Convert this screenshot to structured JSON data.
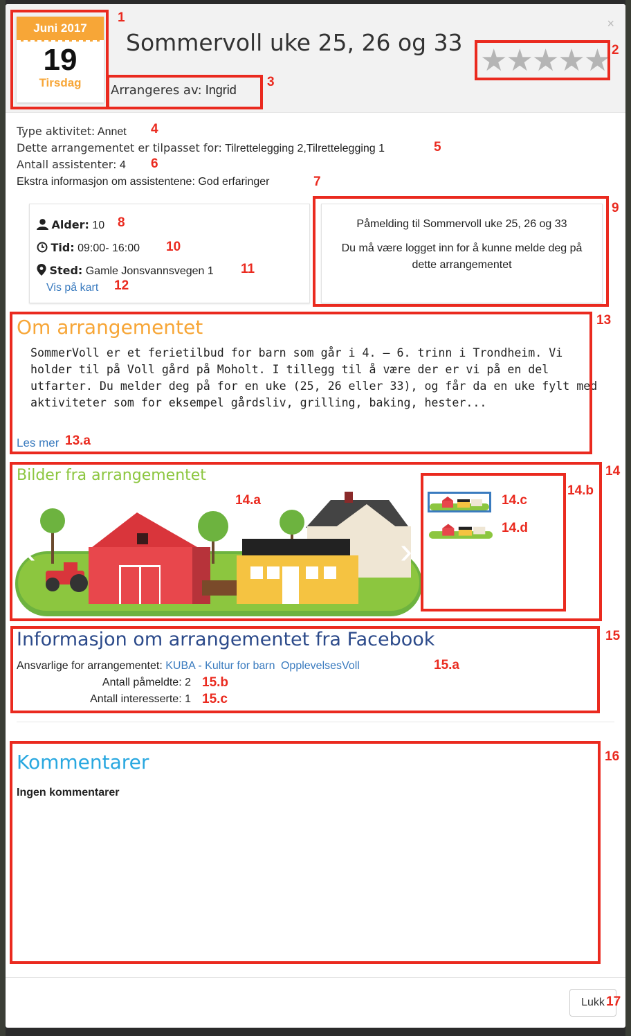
{
  "window": {
    "close_glyph": "×"
  },
  "calendar": {
    "month": "Juni 2017",
    "day": "19",
    "weekday": "Tirsdag"
  },
  "event": {
    "title": "Sommervoll uke 25, 26 og 33",
    "rating_stars": "★★★★★",
    "rating_value": 0,
    "organizer_label": "Arrangeres av:",
    "organizer_value": "Ingrid"
  },
  "details": {
    "type_label": "Type aktivitet:",
    "type_value": "Annet",
    "adapted_label": "Dette arrangementet er tilpasset for:",
    "adapted_value": "Tilrettelegging 2,Tilrettelegging 1",
    "assistants_label": "Antall assistenter:",
    "assistants_value": "4",
    "extra_label": "Ekstra informasjon om assistentene:",
    "extra_value": "God erfaringer"
  },
  "summary_card": {
    "age_label": "Alder:",
    "age_value": "10",
    "time_label": "Tid:",
    "time_value": "09:00- 16:00",
    "place_label": "Sted:",
    "place_value": "Gamle Jonsvannsvegen 1",
    "map_link": "Vis på kart"
  },
  "signup_card": {
    "heading": "Påmelding til Sommervoll uke 25, 26 og 33",
    "message": "Du må være logget inn for å kunne melde deg på dette arrangementet"
  },
  "about": {
    "title": "Om arrangementet",
    "text": "SommerVoll er et ferietilbud for barn som går i 4. – 6. trinn i Trondheim. Vi holder til på Voll gård på Moholt. I tillegg til å være der er vi på en del utfarter. Du melder deg på for en uke (25, 26 eller 33), og får da en uke fylt med aktiviteter som for eksempel gårdsliv, grilling, baking, hester...",
    "read_more": "Les mer"
  },
  "gallery": {
    "title": "Bilder fra arrangementet",
    "prev": "‹",
    "next": "›"
  },
  "facebook": {
    "title": "Informasjon om arrangementet fra Facebook",
    "responsible_label": "Ansvarlige for arrangementet:",
    "responsible_links": [
      "KUBA - Kultur for barn",
      "OpplevelsesVoll"
    ],
    "attending_label": "Antall påmeldte:",
    "attending_value": "2",
    "interested_label": "Antall interesserte:",
    "interested_value": "1"
  },
  "comments": {
    "title": "Kommentarer",
    "empty": "Ingen kommentarer"
  },
  "footer": {
    "close_button": "Lukk"
  },
  "annotations": [
    "1",
    "2",
    "3",
    "4",
    "5",
    "6",
    "7",
    "8",
    "9",
    "10",
    "11",
    "12",
    "13",
    "13.a",
    "14",
    "14.a",
    "14.b",
    "14.c",
    "14.d",
    "15",
    "15.a",
    "15.b",
    "15.c",
    "16",
    "17"
  ],
  "colors": {
    "accent_orange": "#f7a637",
    "link_blue": "#3a7bbf",
    "title_green": "#8cc63f",
    "facebook_blue": "#2c4a8a",
    "comments_blue": "#29a8e0",
    "annotation_red": "#ea2a1f"
  }
}
